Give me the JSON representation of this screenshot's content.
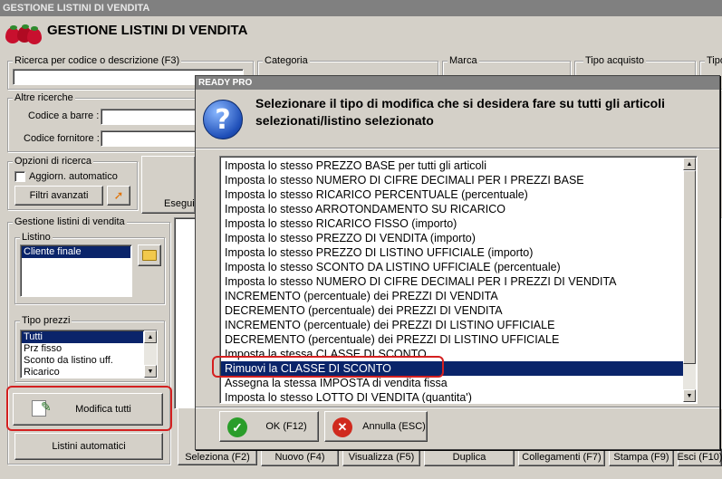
{
  "window": {
    "title": "GESTIONE LISTINI DI VENDITA",
    "header": "GESTIONE LISTINI DI VENDITA"
  },
  "search": {
    "group_label": "Ricerca per codice o descrizione (F3)",
    "categoria_label": "Categoria",
    "marca_label": "Marca",
    "tipo_acquisto_label": "Tipo acquisto",
    "tipo_label": "Tipo"
  },
  "altre_ricerche": {
    "group_label": "Altre ricerche",
    "barcode_label": "Codice a barre :",
    "fornitore_label": "Codice fornitore :"
  },
  "opzioni": {
    "group_label": "Opzioni di ricerca",
    "auto_update_label": "Aggiorn. automatico",
    "filtri_button": "Filtri avanzati",
    "esegui_label": "Esegui"
  },
  "gestione": {
    "group_label": "Gestione listini di vendita",
    "listino_label": "Listino",
    "listini": [
      "Cliente finale"
    ],
    "tipo_prezzi_label": "Tipo prezzi",
    "tipi_prezzi": [
      "Tutti",
      "Prz fisso",
      "Sconto da listino uff.",
      "Ricarico"
    ],
    "modifica_tutti_button": "Modifica tutti",
    "listini_automatici_button": "Listini automatici"
  },
  "toolbar": {
    "buttons": [
      "Seleziona (F2)",
      "Nuovo (F4)",
      "Visualizza (F5)",
      "Duplica",
      "Collegamenti (F7)",
      "Stampa (F9)",
      "Esci (F10)"
    ]
  },
  "dialog": {
    "title": "READY PRO",
    "message": "Selezionare il tipo di modifica che si desidera fare su tutti gli articoli selezionati/listino selezionato",
    "options": [
      "Imposta lo stesso PREZZO BASE per tutti gli articoli",
      "Imposta lo stesso NUMERO DI CIFRE DECIMALI PER I PREZZI BASE",
      "Imposta lo stesso RICARICO PERCENTUALE (percentuale)",
      "Imposta lo stesso ARROTONDAMENTO SU RICARICO",
      "Imposta lo stesso RICARICO FISSO (importo)",
      "Imposta lo stesso PREZZO DI VENDITA (importo)",
      "Imposta lo stesso PREZZO DI LISTINO UFFICIALE (importo)",
      "Imposta lo stesso SCONTO DA LISTINO UFFICIALE (percentuale)",
      "Imposta lo stesso NUMERO DI CIFRE DECIMALI PER I PREZZI DI VENDITA",
      "INCREMENTO (percentuale) dei PREZZI DI VENDITA",
      "DECREMENTO (percentuale) dei PREZZI DI VENDITA",
      "INCREMENTO (percentuale) dei PREZZI DI LISTINO UFFICIALE",
      "DECREMENTO (percentuale) dei PREZZI DI LISTINO UFFICIALE",
      "Imposta la stessa CLASSE DI SCONTO",
      "Rimuovi la CLASSE DI SCONTO",
      "Assegna la stessa IMPOSTA di vendita fissa",
      "Imposta lo stesso LOTTO DI VENDITA (quantita')"
    ],
    "selected_index": 14,
    "ok_button": "OK (F12)",
    "cancel_button": "Annulla (ESC)"
  },
  "colors": {
    "selection": "#0a246a",
    "highlight_ring": "#d42020",
    "title_bar": "#808080"
  }
}
